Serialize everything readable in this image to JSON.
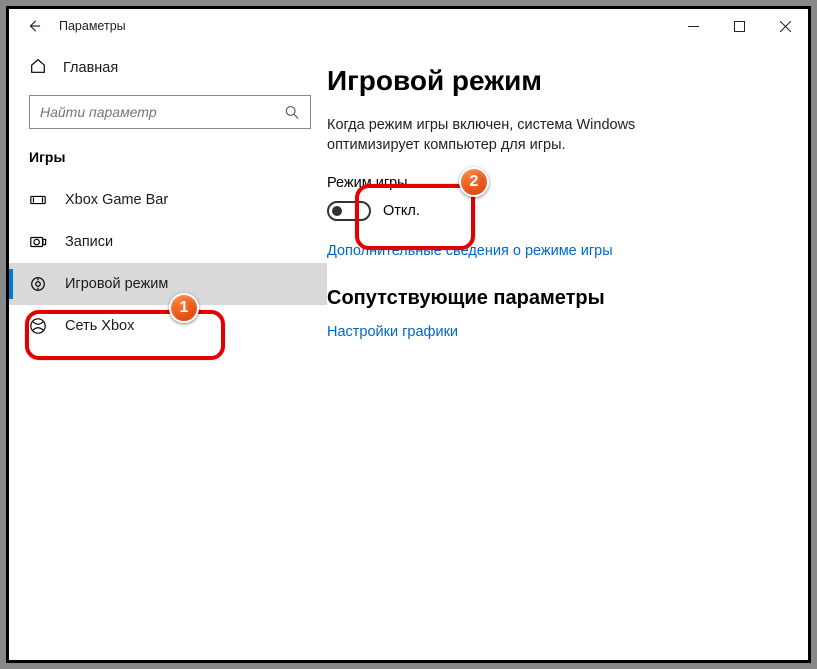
{
  "window": {
    "title": "Параметры"
  },
  "sidebar": {
    "home": "Главная",
    "search_placeholder": "Найти параметр",
    "section": "Игры",
    "items": [
      {
        "label": "Xbox Game Bar"
      },
      {
        "label": "Записи"
      },
      {
        "label": "Игровой режим"
      },
      {
        "label": "Сеть Xbox"
      }
    ]
  },
  "main": {
    "title": "Игровой режим",
    "description": "Когда режим игры включен, система Windows оптимизирует компьютер для игры.",
    "toggle_label": "Режим игры",
    "toggle_state": "Откл.",
    "link_more": "Дополнительные сведения о режиме игры",
    "related_heading": "Сопутствующие параметры",
    "link_graphics": "Настройки графики"
  },
  "annotations": {
    "badge1": "1",
    "badge2": "2"
  }
}
